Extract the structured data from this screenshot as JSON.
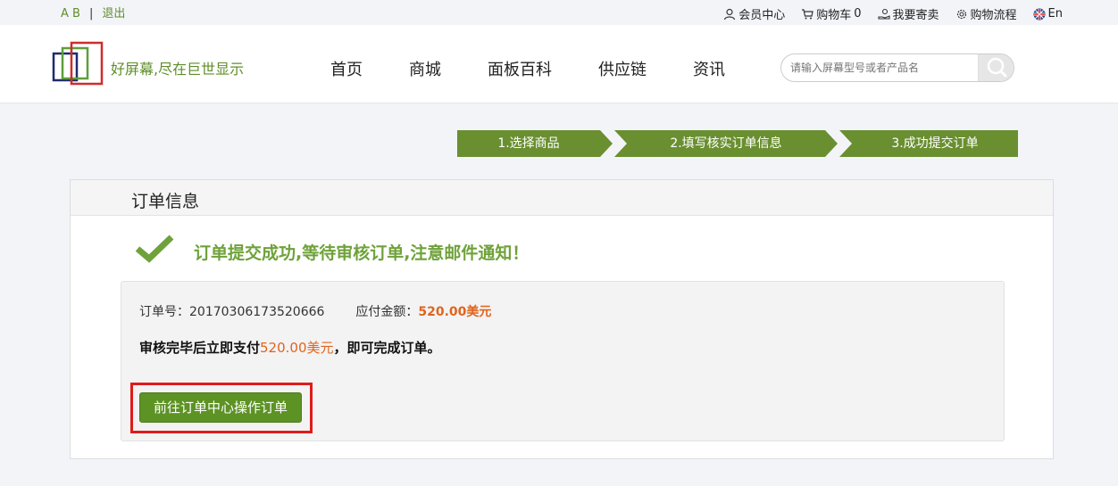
{
  "topbar": {
    "lang_switch": "A B",
    "logout": "退出",
    "member_center": "会员中心",
    "cart_label": "购物车",
    "cart_count": "0",
    "consign": "我要寄卖",
    "process": "购物流程",
    "language": "En"
  },
  "header": {
    "slogan": "好屏幕,尽在巨世显示",
    "nav": [
      "首页",
      "商城",
      "面板百科",
      "供应链",
      "资讯"
    ],
    "search_placeholder": "请输入屏幕型号或者产品名"
  },
  "steps": [
    "1.选择商品",
    "2.填写核实订单信息",
    "3.成功提交订单"
  ],
  "order": {
    "section_title": "订单信息",
    "success_message": "订单提交成功,等待审核订单,注意邮件通知！",
    "order_no_label": "订单号：",
    "order_no": "20170306173520666",
    "amount_label": "应付金额：",
    "amount": "520.00美元",
    "pay_prefix": "审核完毕后立即支付",
    "pay_amount": "520.00美元",
    "pay_suffix": "，即可完成订单。",
    "button_label": "前往订单中心操作订单"
  },
  "colors": {
    "accent": "#6a8f30",
    "amount": "#e0641e",
    "highlight": "#e01b1b"
  }
}
